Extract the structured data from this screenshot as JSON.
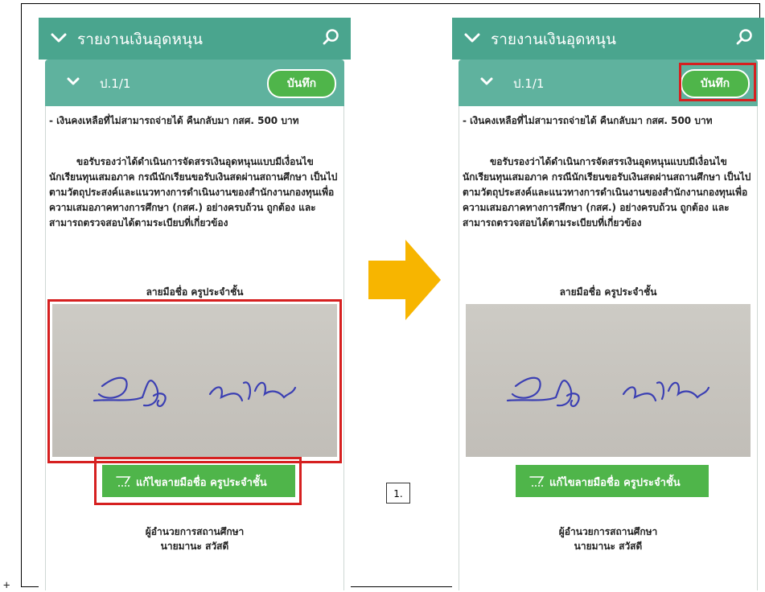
{
  "header": {
    "title": "รายงานเงินอุดหนุน"
  },
  "class_bar": {
    "class_label": "ป.1/1",
    "save_label": "บันทึก"
  },
  "content": {
    "balance_note": "- เงินคงเหลือที่ไม่สามารถจ่ายได้ คืนกลับมา กสศ. 500 บาท",
    "certification": "ขอรับรองว่าได้ดำเนินการจัดสรรเงินอุดหนุนแบบมีเงื่อนไข นักเรียนทุนเสมอภาค กรณีนักเรียนขอรับเงินสดผ่านสถานศึกษา เป็นไปตามวัตถุประสงค์และแนวทางการดำเนินงานของสำนักงานกองทุนเพื่อความเสมอภาคทางการศึกษา (กสศ.) อย่างครบถ้วน ถูกต้อง และสามารถตรวจสอบได้ตามระเบียบที่เกี่ยวข้อง",
    "signature_label": "ลายมือชื่อ ครูประจำชั้น",
    "edit_signature_label": "แก้ไขลายมือชื่อ ครูประจำชั้น",
    "principal_title": "ผู้อำนวยการสถานศึกษา",
    "principal_name": "นายมานะ สวัสดี"
  },
  "annotations": {
    "step_label": "1.",
    "highlight_color": "#d62020",
    "arrow_color": "#f7b500"
  },
  "colors": {
    "app_bar": "#4aa58e",
    "sub_bar": "#5fb29e",
    "button_green": "#4fb54a"
  },
  "icons": [
    "chevron-down-icon",
    "search-icon",
    "pencil-icon"
  ]
}
